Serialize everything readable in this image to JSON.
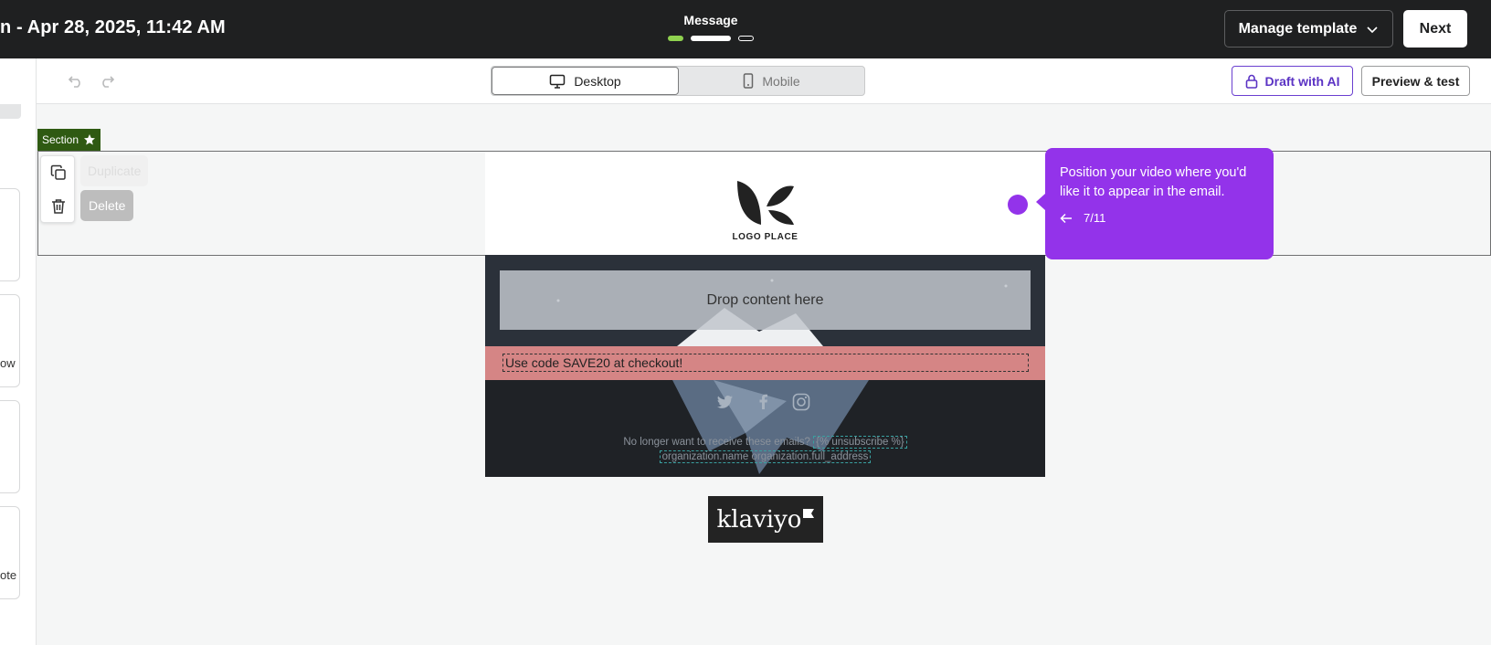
{
  "header": {
    "title": "n - Apr 28, 2025, 11:42 AM",
    "step_label": "Message",
    "manage_template": "Manage template",
    "next": "Next"
  },
  "toolbar": {
    "desktop": "Desktop",
    "mobile": "Mobile",
    "draft_with_ai": "Draft with AI",
    "preview_test": "Preview & test"
  },
  "sidebar": {
    "partial_labels": [
      "ow",
      "ote"
    ]
  },
  "section": {
    "tag": "Section",
    "duplicate": "Duplicate",
    "delete": "Delete"
  },
  "email": {
    "logo_text": "LOGO PLACE",
    "drop_zone": "Drop content here",
    "code_text": "Use code SAVE20 at checkout!",
    "footer_prefix": "No longer want to receive these emails?",
    "unsubscribe": "{% unsubscribe %}",
    "org_name": "organization.name",
    "org_address": "organization.full_address"
  },
  "branding": {
    "klaviyo": "klaviyo"
  },
  "guide": {
    "text": "Position your video where you'd like it to appear in the email.",
    "step": "7/11"
  },
  "colors": {
    "topbar": "#1f2021",
    "accent_purple": "#9333ea",
    "section_tag": "#2f5a12",
    "code_bar": "#d58585",
    "progress_done": "#8fd14f"
  },
  "icons": [
    "undo-icon",
    "redo-icon",
    "desktop-icon",
    "mobile-icon",
    "lock-icon",
    "chevron-down-icon",
    "star-icon",
    "copy-icon",
    "trash-icon",
    "twitter-icon",
    "facebook-icon",
    "instagram-icon",
    "arrow-left-icon"
  ]
}
